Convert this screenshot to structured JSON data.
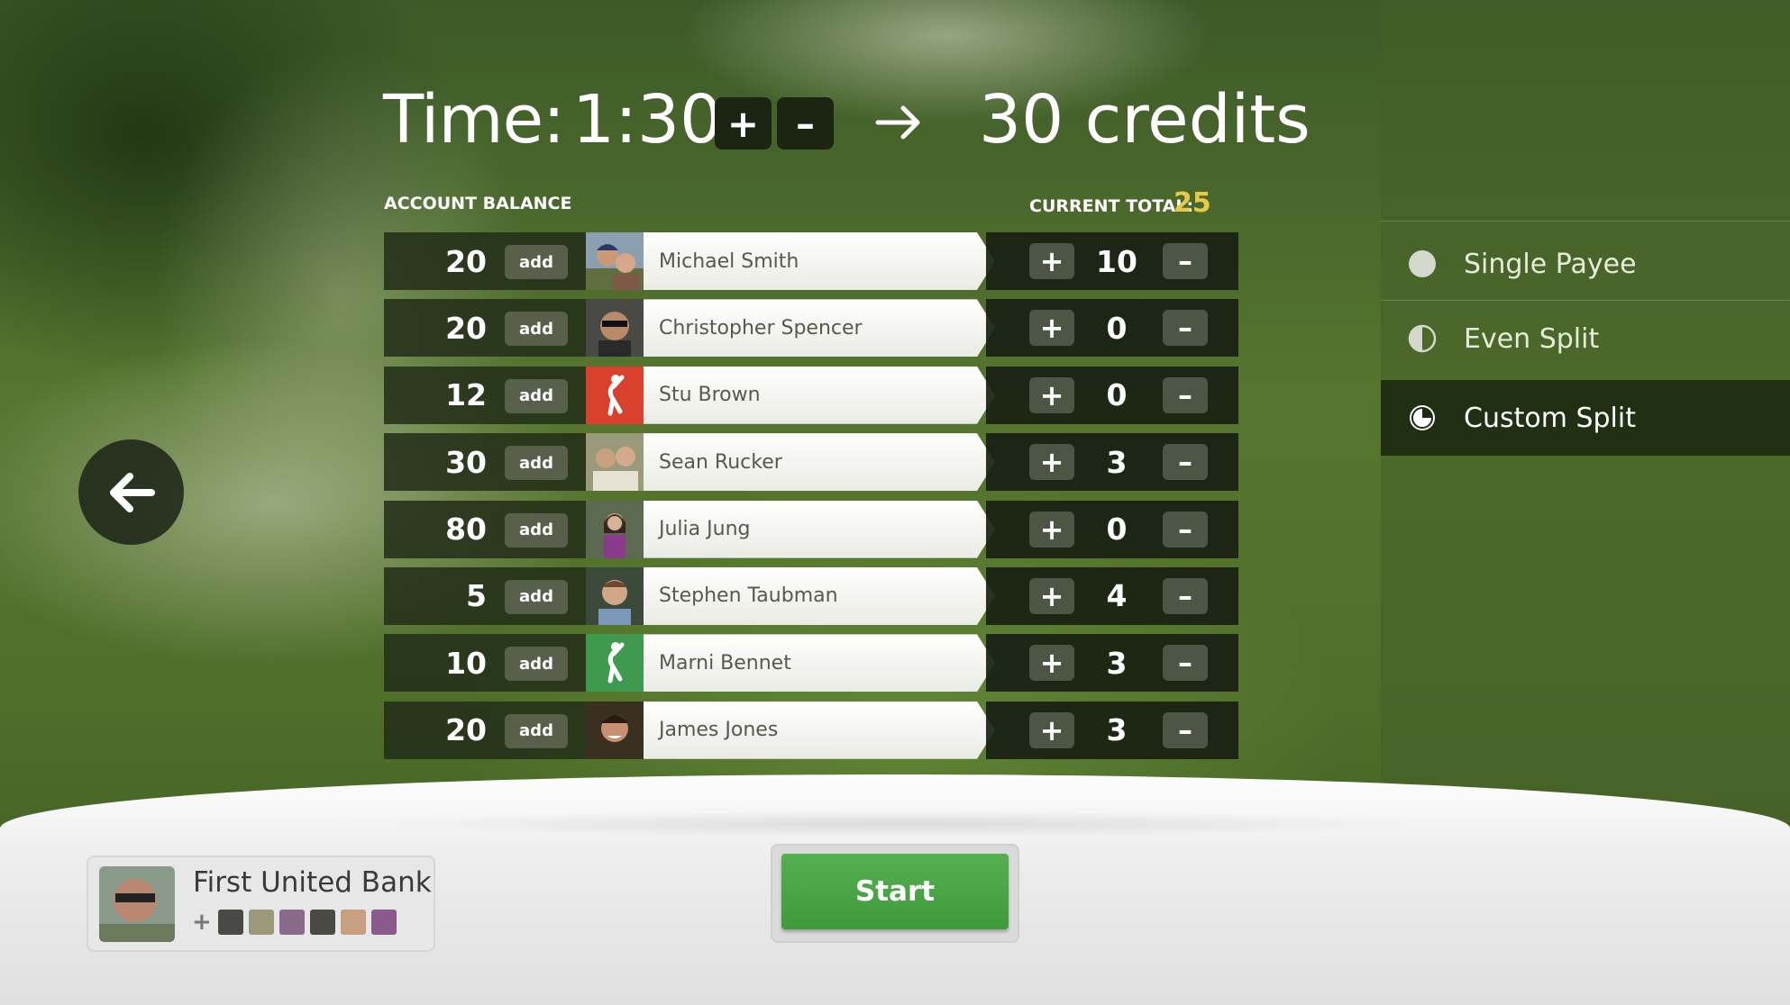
{
  "header": {
    "time_label": "Time:",
    "time_value": "1:30",
    "increase_label": "+",
    "decrease_label": "–",
    "credits_value": "30 credits"
  },
  "labels": {
    "account_balance": "ACCOUNT BALANCE",
    "current_total": "CURRENT TOTAL:",
    "current_total_value": "25"
  },
  "players": [
    {
      "balance": "20",
      "add_label": "add",
      "name": "Michael Smith",
      "share": "10",
      "avatar": "photo"
    },
    {
      "balance": "20",
      "add_label": "add",
      "name": "Christopher Spencer",
      "share": "0",
      "avatar": "photo"
    },
    {
      "balance": "12",
      "add_label": "add",
      "name": "Stu Brown",
      "share": "0",
      "avatar": "golfer-icon-red"
    },
    {
      "balance": "30",
      "add_label": "add",
      "name": "Sean Rucker",
      "share": "3",
      "avatar": "photo"
    },
    {
      "balance": "80",
      "add_label": "add",
      "name": "Julia Jung",
      "share": "0",
      "avatar": "photo"
    },
    {
      "balance": "5",
      "add_label": "add",
      "name": "Stephen Taubman",
      "share": "4",
      "avatar": "photo"
    },
    {
      "balance": "10",
      "add_label": "add",
      "name": "Marni Bennet",
      "share": "3",
      "avatar": "golfer-icon-green"
    },
    {
      "balance": "20",
      "add_label": "add",
      "name": "James Jones",
      "share": "3",
      "avatar": "photo"
    }
  ],
  "row_controls": {
    "plus": "+",
    "minus": "–"
  },
  "split_options": [
    {
      "label": "Single Payee",
      "icon": "full-circle-icon",
      "selected": false
    },
    {
      "label": "Even Split",
      "icon": "half-circle-icon",
      "selected": false
    },
    {
      "label": "Custom Split",
      "icon": "pie-circle-icon",
      "selected": true
    }
  ],
  "payer": {
    "name": "First United Bank",
    "plus": "+"
  },
  "start_label": "Start",
  "colors": {
    "accent_total": "#e8c84a",
    "start_green": "#4aa545",
    "golfer_red": "#d9412e",
    "golfer_green": "#3f9a50"
  }
}
